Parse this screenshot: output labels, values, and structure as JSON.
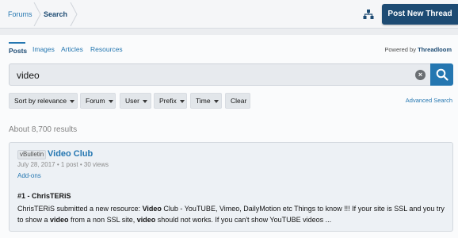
{
  "breadcrumb": {
    "items": [
      "Forums",
      "Search"
    ]
  },
  "header": {
    "post_button": "Post New Thread"
  },
  "tabs": [
    {
      "label": "Posts",
      "active": true
    },
    {
      "label": "Images",
      "active": false
    },
    {
      "label": "Articles",
      "active": false
    },
    {
      "label": "Resources",
      "active": false
    }
  ],
  "powered_by": {
    "prefix": "Powered by",
    "brand": "Threadloom"
  },
  "search": {
    "value": "video"
  },
  "filters": {
    "sort": "Sort by relevance",
    "forum": "Forum",
    "user": "User",
    "prefix": "Prefix",
    "time": "Time",
    "clear": "Clear"
  },
  "advanced_search": "Advanced Search",
  "results": {
    "count_text": "About 8,700 results",
    "items": [
      {
        "prefix": "vBulletin",
        "title": "Video Club",
        "meta": "July 28, 2017 • 1 post • 30 views",
        "category": "Add-ons",
        "snippet_head": "#1 - ChrisTERiS",
        "snippet_parts": [
          "ChrisTERiS submitted a new resource: ",
          "Video",
          " Club - YouTUBE, Vimeo, DailyMotion etc Things to know !!! If your site is SSL and you try to show a ",
          "video",
          " from a non SSL site, ",
          "video",
          " should not works. If you can't show YouTUBE videos ..."
        ]
      }
    ]
  },
  "colors": {
    "accent": "#2577b1",
    "header_dark": "#1d4b73",
    "panel_bg": "#fafbfc"
  }
}
